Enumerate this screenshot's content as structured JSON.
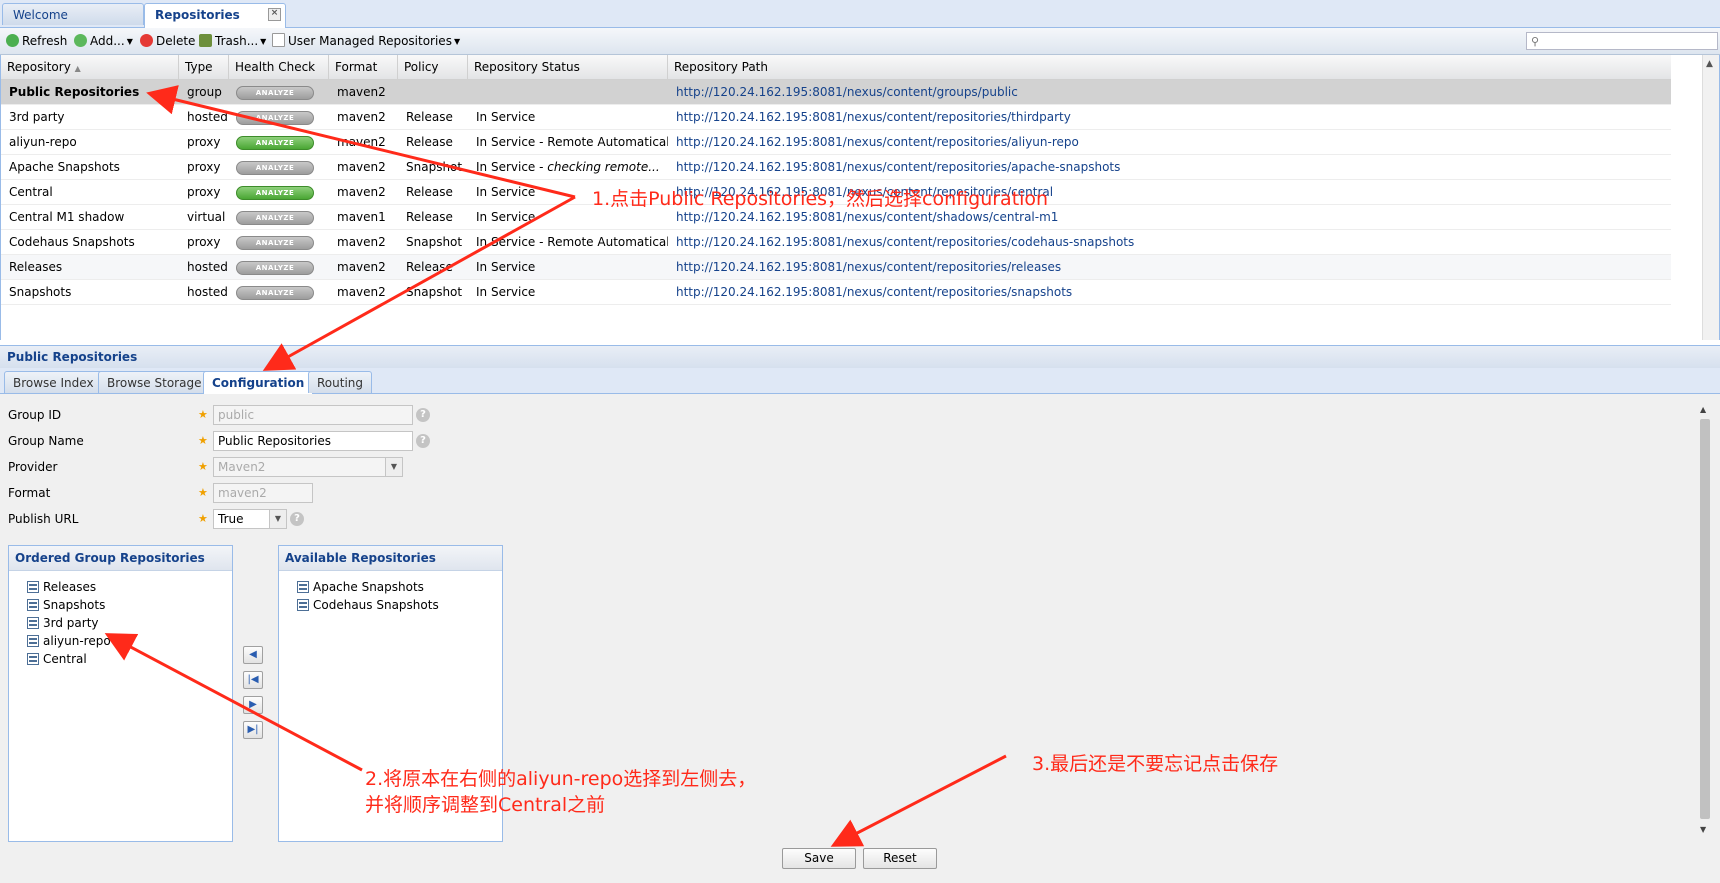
{
  "tabs": [
    {
      "label": "Welcome"
    },
    {
      "label": "Repositories",
      "close": "×"
    }
  ],
  "toolbar": {
    "refresh": "Refresh",
    "add": "Add...",
    "delete": "Delete",
    "trash": "Trash...",
    "user_managed": "User Managed Repositories"
  },
  "grid": {
    "columns": [
      "Repository",
      "Type",
      "Health Check",
      "Format",
      "Policy",
      "Repository Status",
      "Repository Path"
    ],
    "sort_indicator": "▲",
    "rows": [
      {
        "name": "Public Repositories",
        "type": "group",
        "health": "ANALYZE",
        "health_color": "gray",
        "format": "maven2",
        "policy": "",
        "status": "",
        "path": "http://120.24.162.195:8081/nexus/content/groups/public"
      },
      {
        "name": "3rd party",
        "type": "hosted",
        "health": "ANALYZE",
        "health_color": "gray",
        "format": "maven2",
        "policy": "Release",
        "status": "In Service",
        "path": "http://120.24.162.195:8081/nexus/content/repositories/thirdparty"
      },
      {
        "name": "aliyun-repo",
        "type": "proxy",
        "health": "ANALYZE",
        "health_color": "green",
        "format": "maven2",
        "policy": "Release",
        "status": "In Service - Remote Automaticall...",
        "path": "http://120.24.162.195:8081/nexus/content/repositories/aliyun-repo"
      },
      {
        "name": "Apache Snapshots",
        "type": "proxy",
        "health": "ANALYZE",
        "health_color": "gray",
        "format": "maven2",
        "policy": "Snapshot",
        "status": "In Service - checking remote...",
        "path": "http://120.24.162.195:8081/nexus/content/repositories/apache-snapshots"
      },
      {
        "name": "Central",
        "type": "proxy",
        "health": "ANALYZE",
        "health_color": "green",
        "format": "maven2",
        "policy": "Release",
        "status": "In Service",
        "path": "http://120.24.162.195:8081/nexus/content/repositories/central"
      },
      {
        "name": "Central M1 shadow",
        "type": "virtual",
        "health": "ANALYZE",
        "health_color": "gray",
        "format": "maven1",
        "policy": "Release",
        "status": "In Service",
        "path": "http://120.24.162.195:8081/nexus/content/shadows/central-m1"
      },
      {
        "name": "Codehaus Snapshots",
        "type": "proxy",
        "health": "ANALYZE",
        "health_color": "gray",
        "format": "maven2",
        "policy": "Snapshot",
        "status": "In Service - Remote Automaticall...",
        "path": "http://120.24.162.195:8081/nexus/content/repositories/codehaus-snapshots"
      },
      {
        "name": "Releases",
        "type": "hosted",
        "health": "ANALYZE",
        "health_color": "gray",
        "format": "maven2",
        "policy": "Release",
        "status": "In Service",
        "path": "http://120.24.162.195:8081/nexus/content/repositories/releases"
      },
      {
        "name": "Snapshots",
        "type": "hosted",
        "health": "ANALYZE",
        "health_color": "gray",
        "format": "maven2",
        "policy": "Snapshot",
        "status": "In Service",
        "path": "http://120.24.162.195:8081/nexus/content/repositories/snapshots"
      }
    ]
  },
  "detail": {
    "title": "Public Repositories",
    "tabs": [
      "Browse Index",
      "Browse Storage",
      "Configuration",
      "Routing"
    ],
    "active_tab": "Configuration",
    "form": {
      "group_id_label": "Group ID",
      "group_id_value": "public",
      "group_name_label": "Group Name",
      "group_name_value": "Public Repositories",
      "provider_label": "Provider",
      "provider_value": "Maven2",
      "format_label": "Format",
      "format_value": "maven2",
      "publish_url_label": "Publish URL",
      "publish_url_value": "True"
    },
    "ordered": {
      "title": "Ordered Group Repositories",
      "items": [
        "Releases",
        "Snapshots",
        "3rd party",
        "aliyun-repo",
        "Central"
      ]
    },
    "available": {
      "title": "Available Repositories",
      "items": [
        "Apache Snapshots",
        "Codehaus Snapshots"
      ]
    },
    "save": "Save",
    "reset": "Reset"
  },
  "annotations": {
    "step1": "1.点击Public Repositories，然后选择configuration",
    "step2_line1": "2.将原本在右侧的aliyun-repo选择到左侧去，",
    "step2_line2": "并将顺序调整到Central之前",
    "step3": "3.最后还是不要忘记点击保存",
    "color": "#ff2a1a"
  },
  "colors": {
    "accent": "#15428b",
    "panel_border": "#99bbe8",
    "analyze_green": "#4aa634",
    "analyze_gray": "#9d9d9d"
  }
}
